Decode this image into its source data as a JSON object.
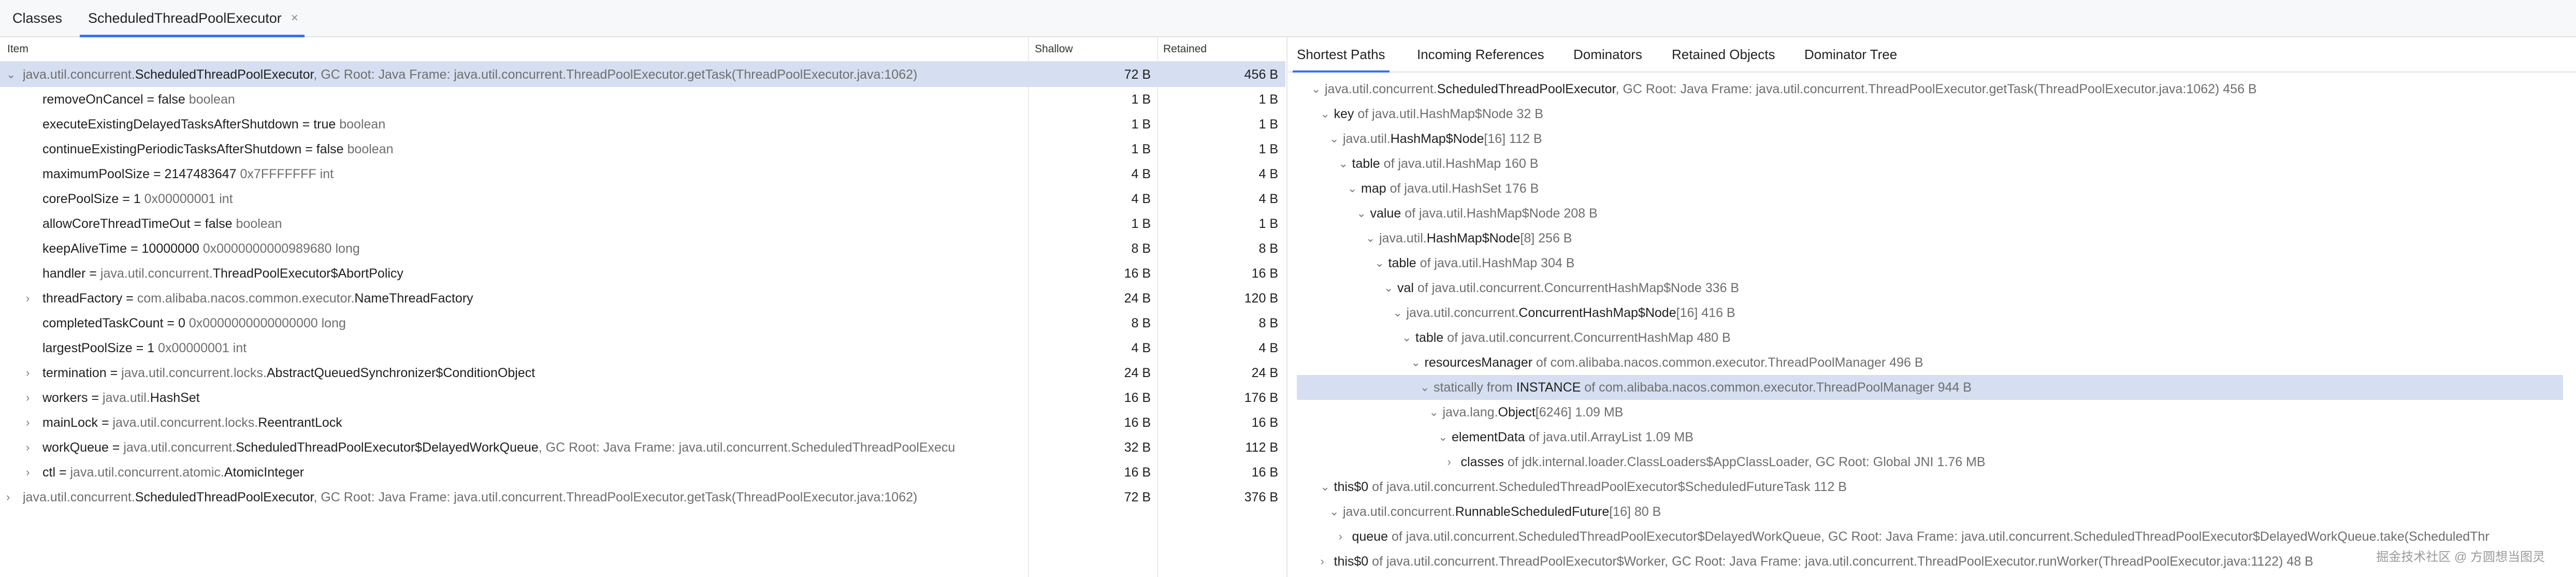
{
  "editor_tabs": {
    "classes": "Classes",
    "active": "ScheduledThreadPoolExecutor",
    "close": "×"
  },
  "table": {
    "headers": {
      "item": "Item",
      "shallow": "Shallow",
      "retained": "Retained"
    },
    "rows": [
      {
        "arrow": "⌄",
        "a": "java.util.concurrent.",
        "b": "ScheduledThreadPoolExecutor",
        "c": ", GC Root: Java Frame: java.util.concurrent.ThreadPoolExecutor.getTask(ThreadPoolExecutor.java:1062)",
        "shallow": "72 B",
        "retained": "456 B",
        "selected": true,
        "indent": 0
      },
      {
        "arrow": "",
        "a": "removeOnCancel = false",
        "b": "",
        "c": " boolean",
        "shallow": "1 B",
        "retained": "1 B",
        "indent": 1
      },
      {
        "arrow": "",
        "a": "executeExistingDelayedTasksAfterShutdown = true",
        "b": "",
        "c": " boolean",
        "shallow": "1 B",
        "retained": "1 B",
        "indent": 1
      },
      {
        "arrow": "",
        "a": "continueExistingPeriodicTasksAfterShutdown = false",
        "b": "",
        "c": " boolean",
        "shallow": "1 B",
        "retained": "1 B",
        "indent": 1
      },
      {
        "arrow": "",
        "a": "maximumPoolSize = 2147483647",
        "b": "",
        "c": " 0x7FFFFFFF  int",
        "shallow": "4 B",
        "retained": "4 B",
        "indent": 1
      },
      {
        "arrow": "",
        "a": "corePoolSize = 1",
        "b": "",
        "c": " 0x00000001  int",
        "shallow": "4 B",
        "retained": "4 B",
        "indent": 1
      },
      {
        "arrow": "",
        "a": "allowCoreThreadTimeOut = false",
        "b": "",
        "c": " boolean",
        "shallow": "1 B",
        "retained": "1 B",
        "indent": 1
      },
      {
        "arrow": "",
        "a": "keepAliveTime = 10000000",
        "b": "",
        "c": " 0x0000000000989680  long",
        "shallow": "8 B",
        "retained": "8 B",
        "indent": 1
      },
      {
        "arrow": "",
        "a": "handler = ",
        "g": "java.util.concurrent.",
        "b": "ThreadPoolExecutor$AbortPolicy",
        "c": "",
        "shallow": "16 B",
        "retained": "16 B",
        "indent": 1
      },
      {
        "arrow": "›",
        "a": "threadFactory = ",
        "g": "com.alibaba.nacos.common.executor.",
        "b": "NameThreadFactory",
        "c": "",
        "shallow": "24 B",
        "retained": "120 B",
        "indent": 1
      },
      {
        "arrow": "",
        "a": "completedTaskCount = 0",
        "b": "",
        "c": " 0x0000000000000000  long",
        "shallow": "8 B",
        "retained": "8 B",
        "indent": 1
      },
      {
        "arrow": "",
        "a": "largestPoolSize = 1",
        "b": "",
        "c": " 0x00000001  int",
        "shallow": "4 B",
        "retained": "4 B",
        "indent": 1
      },
      {
        "arrow": "›",
        "a": "termination = ",
        "g": "java.util.concurrent.locks.",
        "b": "AbstractQueuedSynchronizer$ConditionObject",
        "c": "",
        "shallow": "24 B",
        "retained": "24 B",
        "indent": 1
      },
      {
        "arrow": "›",
        "a": "workers = ",
        "g": "java.util.",
        "b": "HashSet",
        "c": "",
        "shallow": "16 B",
        "retained": "176 B",
        "indent": 1
      },
      {
        "arrow": "›",
        "a": "mainLock = ",
        "g": "java.util.concurrent.locks.",
        "b": "ReentrantLock",
        "c": "",
        "shallow": "16 B",
        "retained": "16 B",
        "indent": 1
      },
      {
        "arrow": "›",
        "a": "workQueue = ",
        "g": "java.util.concurrent.",
        "b": "ScheduledThreadPoolExecutor$DelayedWorkQueue",
        "c": ", GC Root: Java Frame: java.util.concurrent.ScheduledThreadPoolExecu",
        "shallow": "32 B",
        "retained": "112 B",
        "indent": 1
      },
      {
        "arrow": "›",
        "a": "ctl = ",
        "g": "java.util.concurrent.atomic.",
        "b": "AtomicInteger",
        "c": "",
        "shallow": "16 B",
        "retained": "16 B",
        "indent": 1
      },
      {
        "arrow": "›",
        "a": "java.util.concurrent.",
        "b": "ScheduledThreadPoolExecutor",
        "c": ", GC Root: Java Frame: java.util.concurrent.ThreadPoolExecutor.getTask(ThreadPoolExecutor.java:1062)",
        "shallow": "72 B",
        "retained": "376 B",
        "indent": 0
      }
    ]
  },
  "right_tabs": [
    "Shortest Paths",
    "Incoming References",
    "Dominators",
    "Retained Objects",
    "Dominator Tree"
  ],
  "paths": [
    {
      "arrow": "⌄",
      "level": 0,
      "pre": "java.util.concurrent.",
      "name": "ScheduledThreadPoolExecutor",
      "post": ", GC Root: Java Frame: java.util.concurrent.ThreadPoolExecutor.getTask(ThreadPoolExecutor.java:1062) 456 B"
    },
    {
      "arrow": "⌄",
      "level": 1,
      "pre": "",
      "name": "key",
      "post": " of java.util.HashMap$Node 32 B"
    },
    {
      "arrow": "⌄",
      "level": 2,
      "pre": "java.util.",
      "name": "HashMap$Node",
      "post": "[16] 112 B"
    },
    {
      "arrow": "⌄",
      "level": 3,
      "pre": "",
      "name": "table",
      "post": " of java.util.HashMap 160 B"
    },
    {
      "arrow": "⌄",
      "level": 4,
      "pre": "",
      "name": "map",
      "post": " of java.util.HashSet 176 B"
    },
    {
      "arrow": "⌄",
      "level": 5,
      "pre": "",
      "name": "value",
      "post": " of java.util.HashMap$Node 208 B"
    },
    {
      "arrow": "⌄",
      "level": 6,
      "pre": "java.util.",
      "name": "HashMap$Node",
      "post": "[8] 256 B"
    },
    {
      "arrow": "⌄",
      "level": 7,
      "pre": "",
      "name": "table",
      "post": " of java.util.HashMap 304 B"
    },
    {
      "arrow": "⌄",
      "level": 8,
      "pre": "",
      "name": "val",
      "post": " of java.util.concurrent.ConcurrentHashMap$Node 336 B"
    },
    {
      "arrow": "⌄",
      "level": 9,
      "pre": "java.util.concurrent.",
      "name": "ConcurrentHashMap$Node",
      "post": "[16] 416 B"
    },
    {
      "arrow": "⌄",
      "level": 10,
      "pre": "",
      "name": "table",
      "post": " of java.util.concurrent.ConcurrentHashMap 480 B"
    },
    {
      "arrow": "⌄",
      "level": 11,
      "pre": "",
      "name": "resourcesManager",
      "post": " of com.alibaba.nacos.common.executor.ThreadPoolManager 496 B"
    },
    {
      "arrow": "⌄",
      "level": 12,
      "pre": "statically from ",
      "name": "INSTANCE",
      "post": " of com.alibaba.nacos.common.executor.ThreadPoolManager 944 B",
      "selected": true
    },
    {
      "arrow": "⌄",
      "level": 13,
      "pre": "java.lang.",
      "name": "Object",
      "post": "[6246] 1.09 MB"
    },
    {
      "arrow": "⌄",
      "level": 14,
      "pre": "",
      "name": "elementData",
      "post": " of java.util.ArrayList 1.09 MB"
    },
    {
      "arrow": "›",
      "level": 15,
      "pre": "",
      "name": "classes",
      "post": " of jdk.internal.loader.ClassLoaders$AppClassLoader, GC Root: Global JNI 1.76 MB"
    },
    {
      "arrow": "⌄",
      "level": 1,
      "pre": "",
      "name": "this$0",
      "post": " of java.util.concurrent.ScheduledThreadPoolExecutor$ScheduledFutureTask 112 B"
    },
    {
      "arrow": "⌄",
      "level": 2,
      "pre": "java.util.concurrent.",
      "name": "RunnableScheduledFuture",
      "post": "[16] 80 B"
    },
    {
      "arrow": "›",
      "level": 3,
      "pre": "",
      "name": "queue",
      "post": " of java.util.concurrent.ScheduledThreadPoolExecutor$DelayedWorkQueue, GC Root: Java Frame: java.util.concurrent.ScheduledThreadPoolExecutor$DelayedWorkQueue.take(ScheduledThr"
    },
    {
      "arrow": "›",
      "level": 1,
      "pre": "",
      "name": "this$0",
      "post": " of java.util.concurrent.ThreadPoolExecutor$Worker, GC Root: Java Frame: java.util.concurrent.ThreadPoolExecutor.runWorker(ThreadPoolExecutor.java:1122) 48 B"
    }
  ],
  "watermark": "掘金技术社区 @ 方圆想当图灵"
}
